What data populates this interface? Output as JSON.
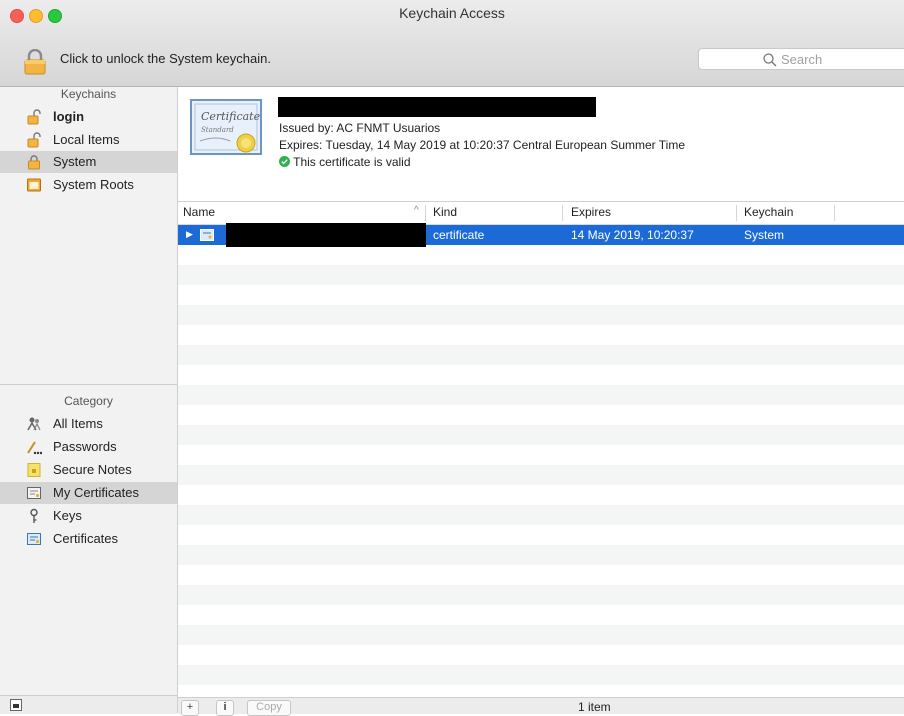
{
  "window": {
    "title": "Keychain Access",
    "unlock_text": "Click to unlock the System keychain.",
    "search_placeholder": "Search"
  },
  "sidebar": {
    "keychains_header": "Keychains",
    "keychains": [
      {
        "label": "login",
        "icon": "unlocked-padlock-icon",
        "bold": true
      },
      {
        "label": "Local Items",
        "icon": "unlocked-padlock-icon"
      },
      {
        "label": "System",
        "icon": "locked-padlock-icon",
        "selected": true
      },
      {
        "label": "System Roots",
        "icon": "cabinet-icon"
      }
    ],
    "category_header": "Category",
    "categories": [
      {
        "label": "All Items",
        "icon": "people-icon"
      },
      {
        "label": "Passwords",
        "icon": "pencil-dots-icon"
      },
      {
        "label": "Secure Notes",
        "icon": "note-icon"
      },
      {
        "label": "My Certificates",
        "icon": "certificate-icon",
        "selected": true
      },
      {
        "label": "Keys",
        "icon": "key-icon"
      },
      {
        "label": "Certificates",
        "icon": "certificate-icon"
      }
    ]
  },
  "detail": {
    "cert_badge_line1": "Certificate",
    "cert_badge_line2": "Standard",
    "issued_by": "Issued by: AC FNMT Usuarios",
    "expires": "Expires: Tuesday, 14 May 2019 at 10:20:37 Central European Summer Time",
    "validity": "This certificate is valid"
  },
  "table": {
    "columns": [
      "Name",
      "Kind",
      "Expires",
      "Keychain"
    ],
    "rows": [
      {
        "kind": "certificate",
        "expires": "14 May 2019, 10:20:37",
        "keychain": "System",
        "selected": true
      }
    ]
  },
  "footer": {
    "add_label": "+",
    "info_label": "i",
    "copy_label": "Copy",
    "item_count": "1 item"
  },
  "colors": {
    "selection": "#1b6ad6",
    "sidebar_selection": "#d5d5d5",
    "valid_green": "#2fb24a"
  }
}
